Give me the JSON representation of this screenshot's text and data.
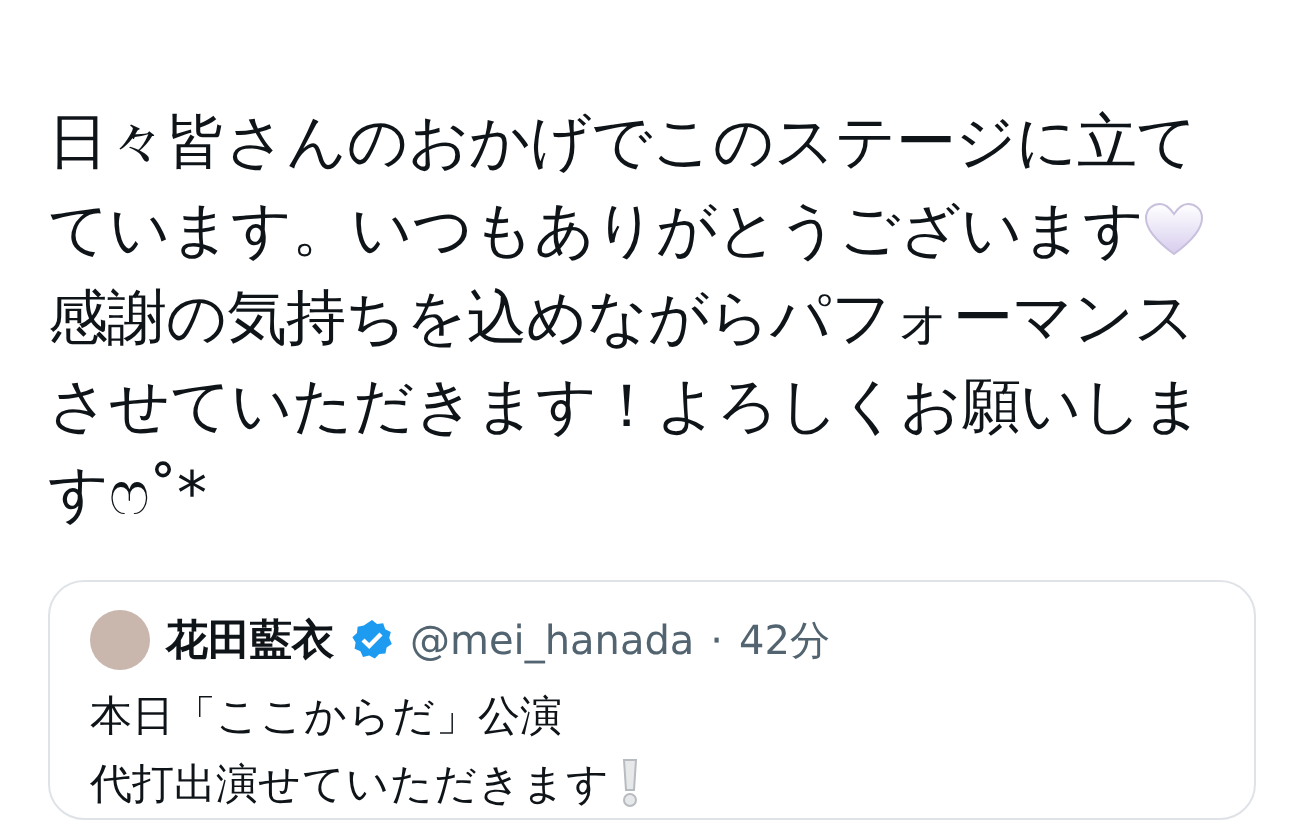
{
  "post": {
    "lines": [
      {
        "kind": "plain",
        "text": "日々皆さんのおかげでこのステージに立て"
      },
      {
        "kind": "heart",
        "text": "ています。いつもありがとうございます"
      },
      {
        "kind": "plain",
        "text": "感謝の気持ちを込めながらパフォーマンス"
      },
      {
        "kind": "plain",
        "text": "させていただきます！よろしくお願いしま"
      },
      {
        "kind": "plain",
        "text": "すෆ˚*"
      }
    ]
  },
  "quoted_post": {
    "display_name": "花田藍衣",
    "verified": true,
    "handle": "@mei_hanada",
    "separator": "·",
    "time": "42分",
    "lines": [
      {
        "kind": "plain",
        "text": "本日「ここからだ」公演"
      },
      {
        "kind": "exclamation",
        "text": "代打出演せていただきます"
      }
    ]
  }
}
